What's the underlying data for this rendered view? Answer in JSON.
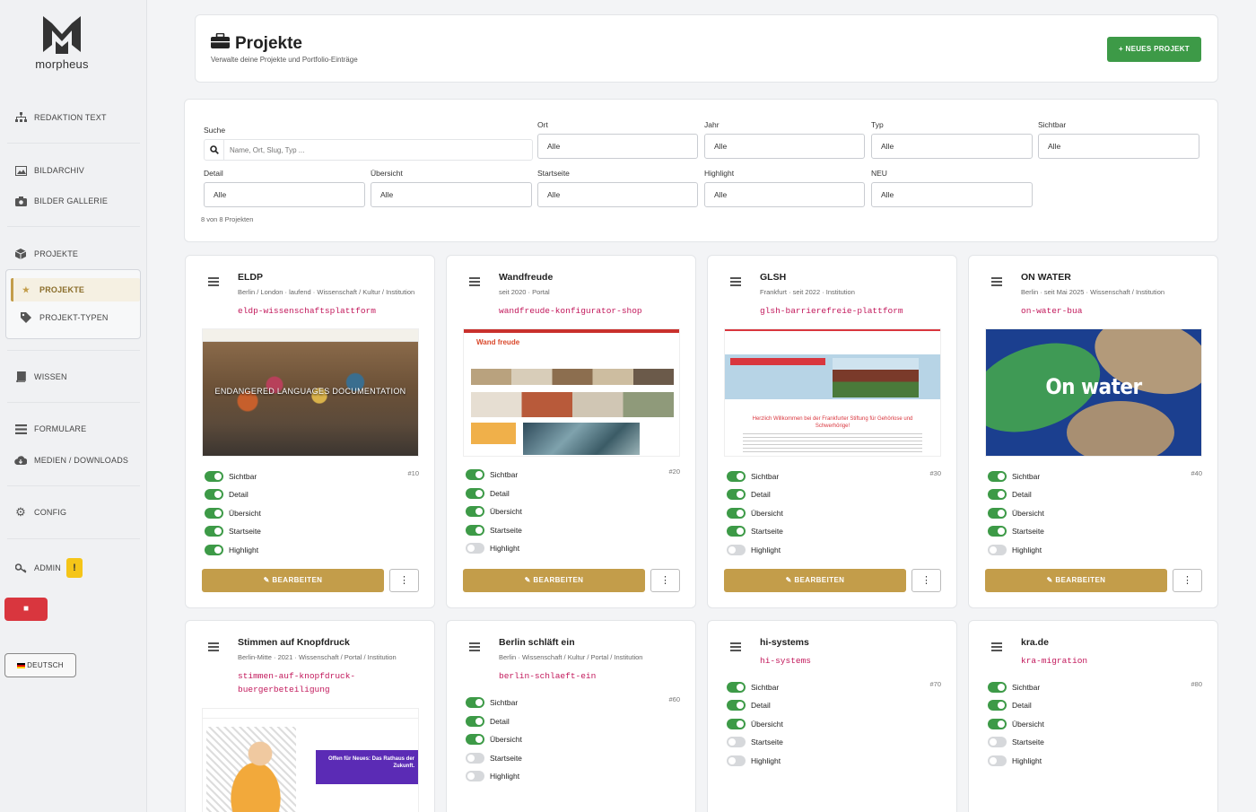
{
  "sidebar": {
    "brand": "morpheus",
    "items": [
      {
        "label": "REDAKTION TEXT",
        "icon": "sitemap-icon"
      },
      {
        "label": "BILDARCHIV",
        "icon": "image-archive-icon"
      },
      {
        "label": "BILDER GALLERIE",
        "icon": "camera-icon"
      },
      {
        "label": "PROJEKTE",
        "icon": "box-icon"
      },
      {
        "label": "PROJEKTE",
        "icon": "star-icon"
      },
      {
        "label": "PROJEKT-TYPEN",
        "icon": "tag-icon"
      },
      {
        "label": "WISSEN",
        "icon": "book-icon"
      },
      {
        "label": "FORMULARE",
        "icon": "list-icon"
      },
      {
        "label": "MEDIEN / DOWNLOADS",
        "icon": "cloud-download-icon"
      },
      {
        "label": "CONFIG",
        "icon": "gear-icon"
      },
      {
        "label": "ADMIN",
        "icon": "key-icon"
      }
    ],
    "admin_badge": "!",
    "language": "DEUTSCH"
  },
  "header": {
    "title": "Projekte",
    "subtitle": "Verwalte deine Projekte und Portfolio-Einträge",
    "new_button": "+ NEUES PROJEKT"
  },
  "filters": {
    "search_label": "Suche",
    "search_placeholder": "Name, Ort, Slug, Typ ...",
    "fields": [
      {
        "label": "Ort",
        "value": "Alle"
      },
      {
        "label": "Jahr",
        "value": "Alle"
      },
      {
        "label": "Typ",
        "value": "Alle"
      },
      {
        "label": "Sichtbar",
        "value": "Alle"
      },
      {
        "label": "Detail",
        "value": "Alle"
      },
      {
        "label": "Übersicht",
        "value": "Alle"
      },
      {
        "label": "Startseite",
        "value": "Alle"
      },
      {
        "label": "Highlight",
        "value": "Alle"
      },
      {
        "label": "NEU",
        "value": "Alle"
      }
    ],
    "count": "8 von 8 Projekten"
  },
  "toggle_labels": [
    "Sichtbar",
    "Detail",
    "Übersicht",
    "Startseite",
    "Highlight"
  ],
  "edit_label": "BEARBEITEN",
  "more_label": "⋮",
  "projects": [
    {
      "name": "ELDP",
      "meta": "Berlin / London · laufend · Wissenschaft / Kultur / Institution",
      "slug": "eldp-wissenschaftsplattform",
      "id": "#10",
      "thumb_text": "ENDANGERED LANGUAGES DOCUMENTATION",
      "toggles": [
        true,
        true,
        true,
        true,
        true
      ]
    },
    {
      "name": "Wandfreude",
      "meta": "seit 2020 · Portal",
      "slug": "wandfreude-konfigurator-shop",
      "id": "#20",
      "thumb_text": "Wand freude",
      "toggles": [
        true,
        true,
        true,
        true,
        false
      ]
    },
    {
      "name": "GLSH",
      "meta": "Frankfurt · seit 2022 · Institution",
      "slug": "glsh-barrierefreie-plattform",
      "id": "#30",
      "thumb_text": "Herzlich Willkommen bei der Frankfurter Stiftung für Gehörlose und Schwerhörige!",
      "toggles": [
        true,
        true,
        true,
        true,
        false
      ]
    },
    {
      "name": "ON WATER",
      "meta": "Berlin · seit Mai 2025 · Wissenschaft / Institution",
      "slug": "on-water-bua",
      "id": "#40",
      "thumb_text": "On water",
      "toggles": [
        true,
        true,
        true,
        true,
        false
      ]
    },
    {
      "name": "Stimmen auf Knopfdruck",
      "meta": "Berlin-Mitte · 2021 · Wissenschaft / Portal / Institution",
      "slug": "stimmen-auf-knopfdruck-buergerbeteiligung",
      "id": "",
      "thumb_text": "Offen für Neues: Das Rathaus der Zukunft.",
      "toggles": []
    },
    {
      "name": "Berlin schläft ein",
      "meta": "Berlin · Wissenschaft / Kultur / Portal / Institution",
      "slug": "berlin-schlaeft-ein",
      "id": "#60",
      "toggles": [
        true,
        true,
        true,
        false,
        false
      ]
    },
    {
      "name": "hi-systems",
      "meta": "",
      "slug": "hi-systems",
      "id": "#70",
      "toggles": [
        true,
        true,
        true,
        false,
        false
      ]
    },
    {
      "name": "kra.de",
      "meta": "",
      "slug": "kra-migration",
      "id": "#80",
      "toggles": [
        true,
        true,
        true,
        false,
        false
      ]
    }
  ]
}
